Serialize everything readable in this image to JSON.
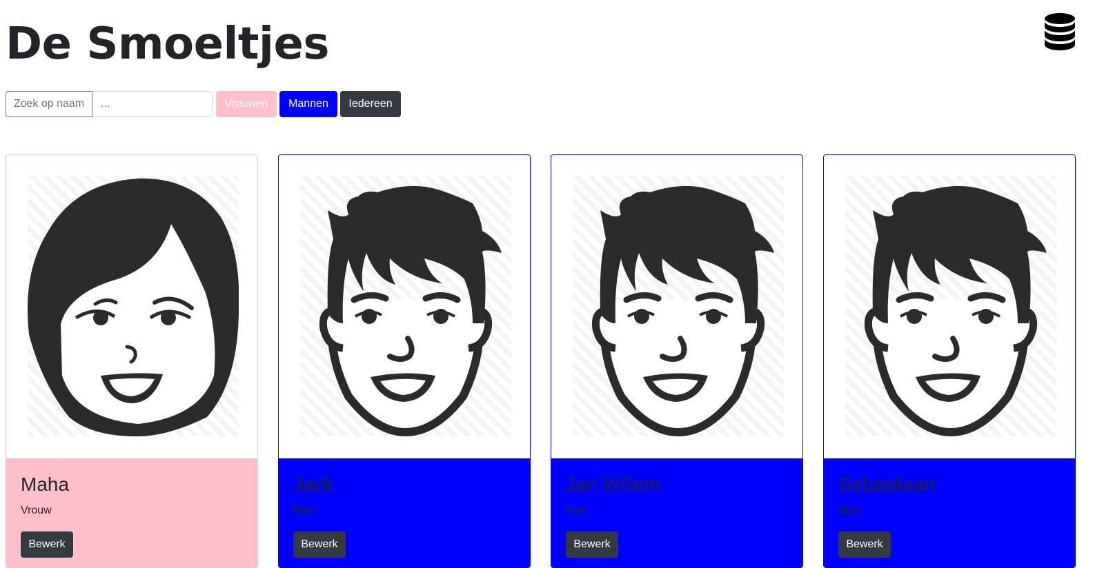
{
  "app": {
    "title": "De Smoeltjes",
    "database_icon": "database-icon"
  },
  "filter": {
    "search_label": "Zoek op naam",
    "search_placeholder": "...",
    "search_value": "",
    "women_label": "Vrouwen",
    "men_label": "Mannen",
    "all_label": "Iedereen"
  },
  "colors": {
    "women": "#ffc0cb",
    "men": "#0000ff",
    "dark": "#343a40"
  },
  "people": [
    {
      "name": "Maha",
      "gender": "Vrouw",
      "button": "Bewerk",
      "icon": "female-face-icon"
    },
    {
      "name": "Jack",
      "gender": "Man",
      "button": "Bewerk",
      "icon": "male-face-icon"
    },
    {
      "name": "Jan Willem",
      "gender": "Man",
      "button": "Bewerk",
      "icon": "male-face-icon"
    },
    {
      "name": "Sebastiaan",
      "gender": "Man",
      "button": "Bewerk",
      "icon": "male-face-icon"
    }
  ]
}
